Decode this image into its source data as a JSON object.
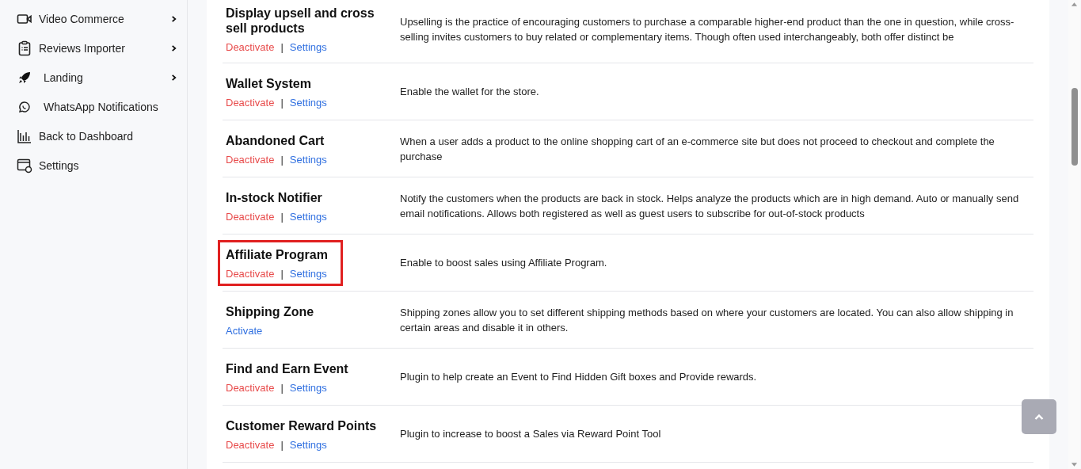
{
  "sidebar": {
    "items": [
      {
        "label": "Video Commerce",
        "has_submenu": true
      },
      {
        "label": "Reviews Importer",
        "has_submenu": true
      },
      {
        "label": "Landing",
        "has_submenu": true
      },
      {
        "label": "WhatsApp Notifications",
        "has_submenu": false
      },
      {
        "label": "Back to Dashboard",
        "has_submenu": false
      },
      {
        "label": "Settings",
        "has_submenu": false
      }
    ]
  },
  "plugins": [
    {
      "title": "Display upsell and cross sell products",
      "active": true,
      "highlighted": false,
      "deactivate": "Deactivate",
      "settings": "Settings",
      "separator": "|",
      "description": "Upselling is the practice of encouraging customers to purchase a comparable higher-end product than the one in question, while cross-selling invites customers to buy related or complementary items. Though often used interchangeably, both offer distinct be"
    },
    {
      "title": "Wallet System",
      "active": true,
      "highlighted": false,
      "deactivate": "Deactivate",
      "settings": "Settings",
      "separator": "|",
      "description": "Enable the wallet for the store."
    },
    {
      "title": "Abandoned Cart",
      "active": true,
      "highlighted": false,
      "deactivate": "Deactivate",
      "settings": "Settings",
      "separator": "|",
      "description": "When a user adds a product to the online shopping cart of an e-commerce site but does not proceed to checkout and complete the purchase"
    },
    {
      "title": "In-stock Notifier",
      "active": true,
      "highlighted": false,
      "deactivate": "Deactivate",
      "settings": "Settings",
      "separator": "|",
      "description": "Notify the customers when the products are back in stock. Helps analyze the products which are in high demand. Auto or manually send email notifications. Allows both registered as well as guest users to subscribe for out-of-stock products"
    },
    {
      "title": "Affiliate Program",
      "active": true,
      "highlighted": true,
      "deactivate": "Deactivate",
      "settings": "Settings",
      "separator": "|",
      "description": "Enable to boost sales using Affiliate Program."
    },
    {
      "title": "Shipping Zone",
      "active": false,
      "highlighted": false,
      "activate": "Activate",
      "description": "Shipping zones allow you to set different shipping methods based on where your customers are located. You can also allow shipping in certain areas and disable it in others."
    },
    {
      "title": "Find and Earn Event",
      "active": true,
      "highlighted": false,
      "deactivate": "Deactivate",
      "settings": "Settings",
      "separator": "|",
      "description": "Plugin to help create an Event to Find Hidden Gift boxes and Provide rewards."
    },
    {
      "title": "Customer Reward Points",
      "active": true,
      "highlighted": false,
      "deactivate": "Deactivate",
      "settings": "Settings",
      "separator": "|",
      "description": "Plugin to increase to boost a Sales via Reward Point Tool"
    }
  ]
}
